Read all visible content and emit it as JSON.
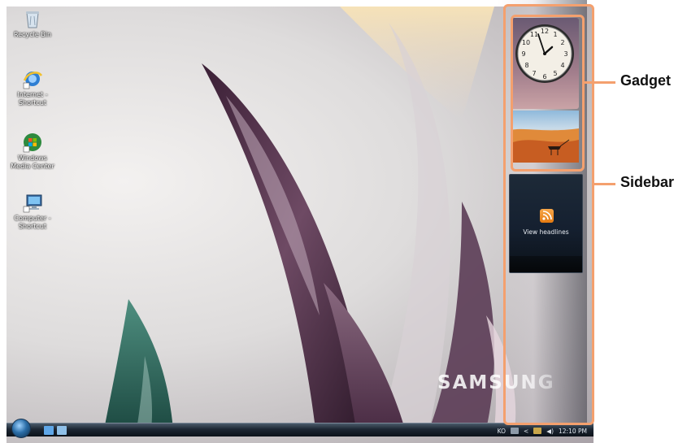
{
  "desktop": {
    "icons": [
      {
        "label": "Recycle Bin",
        "icon": "recycle-bin-icon"
      },
      {
        "label": "Internet - Shortcut",
        "icon": "internet-explorer-icon"
      },
      {
        "label": "Windows Media Center",
        "icon": "windows-media-center-icon"
      },
      {
        "label": "Computer - Shortcut",
        "icon": "computer-icon"
      }
    ],
    "brand": "SAMSUNG"
  },
  "sidebar": {
    "clock": {
      "icon": "clock-icon",
      "hours": 1,
      "minutes": 52
    },
    "slideshow": {
      "icon": "desert-photo"
    },
    "feed": {
      "icon": "rss-icon",
      "label": "View headlines"
    }
  },
  "taskbar": {
    "start_icon": "windows-start-orb",
    "tray": {
      "language": "KO",
      "expand": "<",
      "time": "12:10 PM"
    }
  },
  "callouts": {
    "gadget": "Gadget",
    "sidebar": "Sidebar"
  },
  "colors": {
    "callout": "#f4a06e",
    "feed_bg": "#152030",
    "taskbar": "#1c2632"
  }
}
